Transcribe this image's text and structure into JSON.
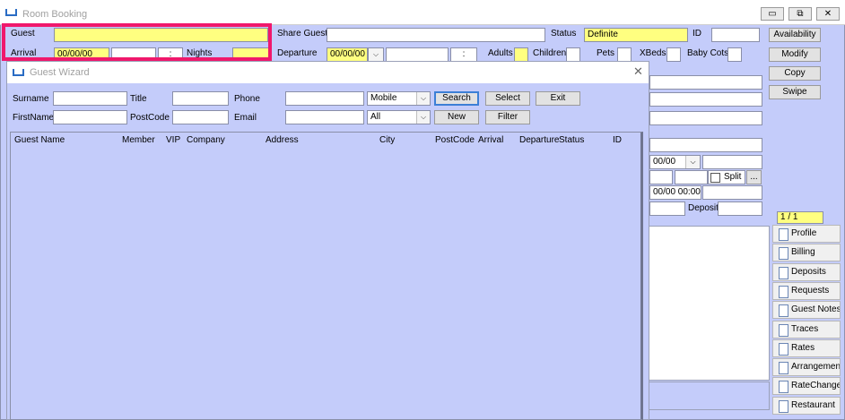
{
  "main_window": {
    "title": "Room Booking",
    "window_buttons": [
      "▭",
      "⧉",
      "✕"
    ],
    "guest_label": "Guest",
    "guest_value": "",
    "share_guest_label": "Share Guest",
    "share_guest_value": "",
    "status_label": "Status",
    "status_value": "Definite",
    "id_label": "ID",
    "id_value": "",
    "arrival_label": "Arrival",
    "arrival_value": "00/00/00",
    "arrival_time_sep": ":",
    "nights_label": "Nights",
    "departure_label": "Departure",
    "departure_value": "00/00/00",
    "departure_time_sep": ":",
    "adults_label": "Adults",
    "children_label": "Children",
    "pets_label": "Pets",
    "xbeds_label": "XBeds",
    "baby_cots_label": "Baby Cots",
    "right_buttons": [
      "Availability",
      "Modify",
      "Copy",
      "Swipe"
    ],
    "date_field_value": "00/00",
    "split_label": "Split",
    "ellipsis_label": "...",
    "datetime_value": "00/00 00:00",
    "deposit_label": "Deposit",
    "record_counter": "1 / 1",
    "side_tabs": [
      "Profile",
      "Billing",
      "Deposits",
      "Requests",
      "Guest Notes",
      "Traces",
      "Rates",
      "Arrangements",
      "RateChange",
      "Restaurant"
    ]
  },
  "guest_wizard": {
    "title": "Guest Wizard",
    "close_symbol": "✕",
    "surname_label": "Surname",
    "surname_value": "",
    "title_label": "Title",
    "title_value": "",
    "phone_label": "Phone",
    "phone_value": "",
    "phone_type_selected": "Mobile",
    "firstname_label": "FirstName",
    "firstname_value": "",
    "postcode_label": "PostCode",
    "postcode_value": "",
    "email_label": "Email",
    "email_value": "",
    "filter_scope_selected": "All",
    "buttons": {
      "search": "Search",
      "select": "Select",
      "exit": "Exit",
      "new": "New",
      "filter": "Filter"
    },
    "columns": [
      "Guest Name",
      "Member",
      "VIP",
      "Company",
      "Address",
      "City",
      "PostCode",
      "Arrival",
      "Departure",
      "Status",
      "ID"
    ]
  },
  "colors": {
    "panel": "#c4ccfa",
    "highlight_input": "#ffff80",
    "annotation_box": "#f0186c"
  }
}
